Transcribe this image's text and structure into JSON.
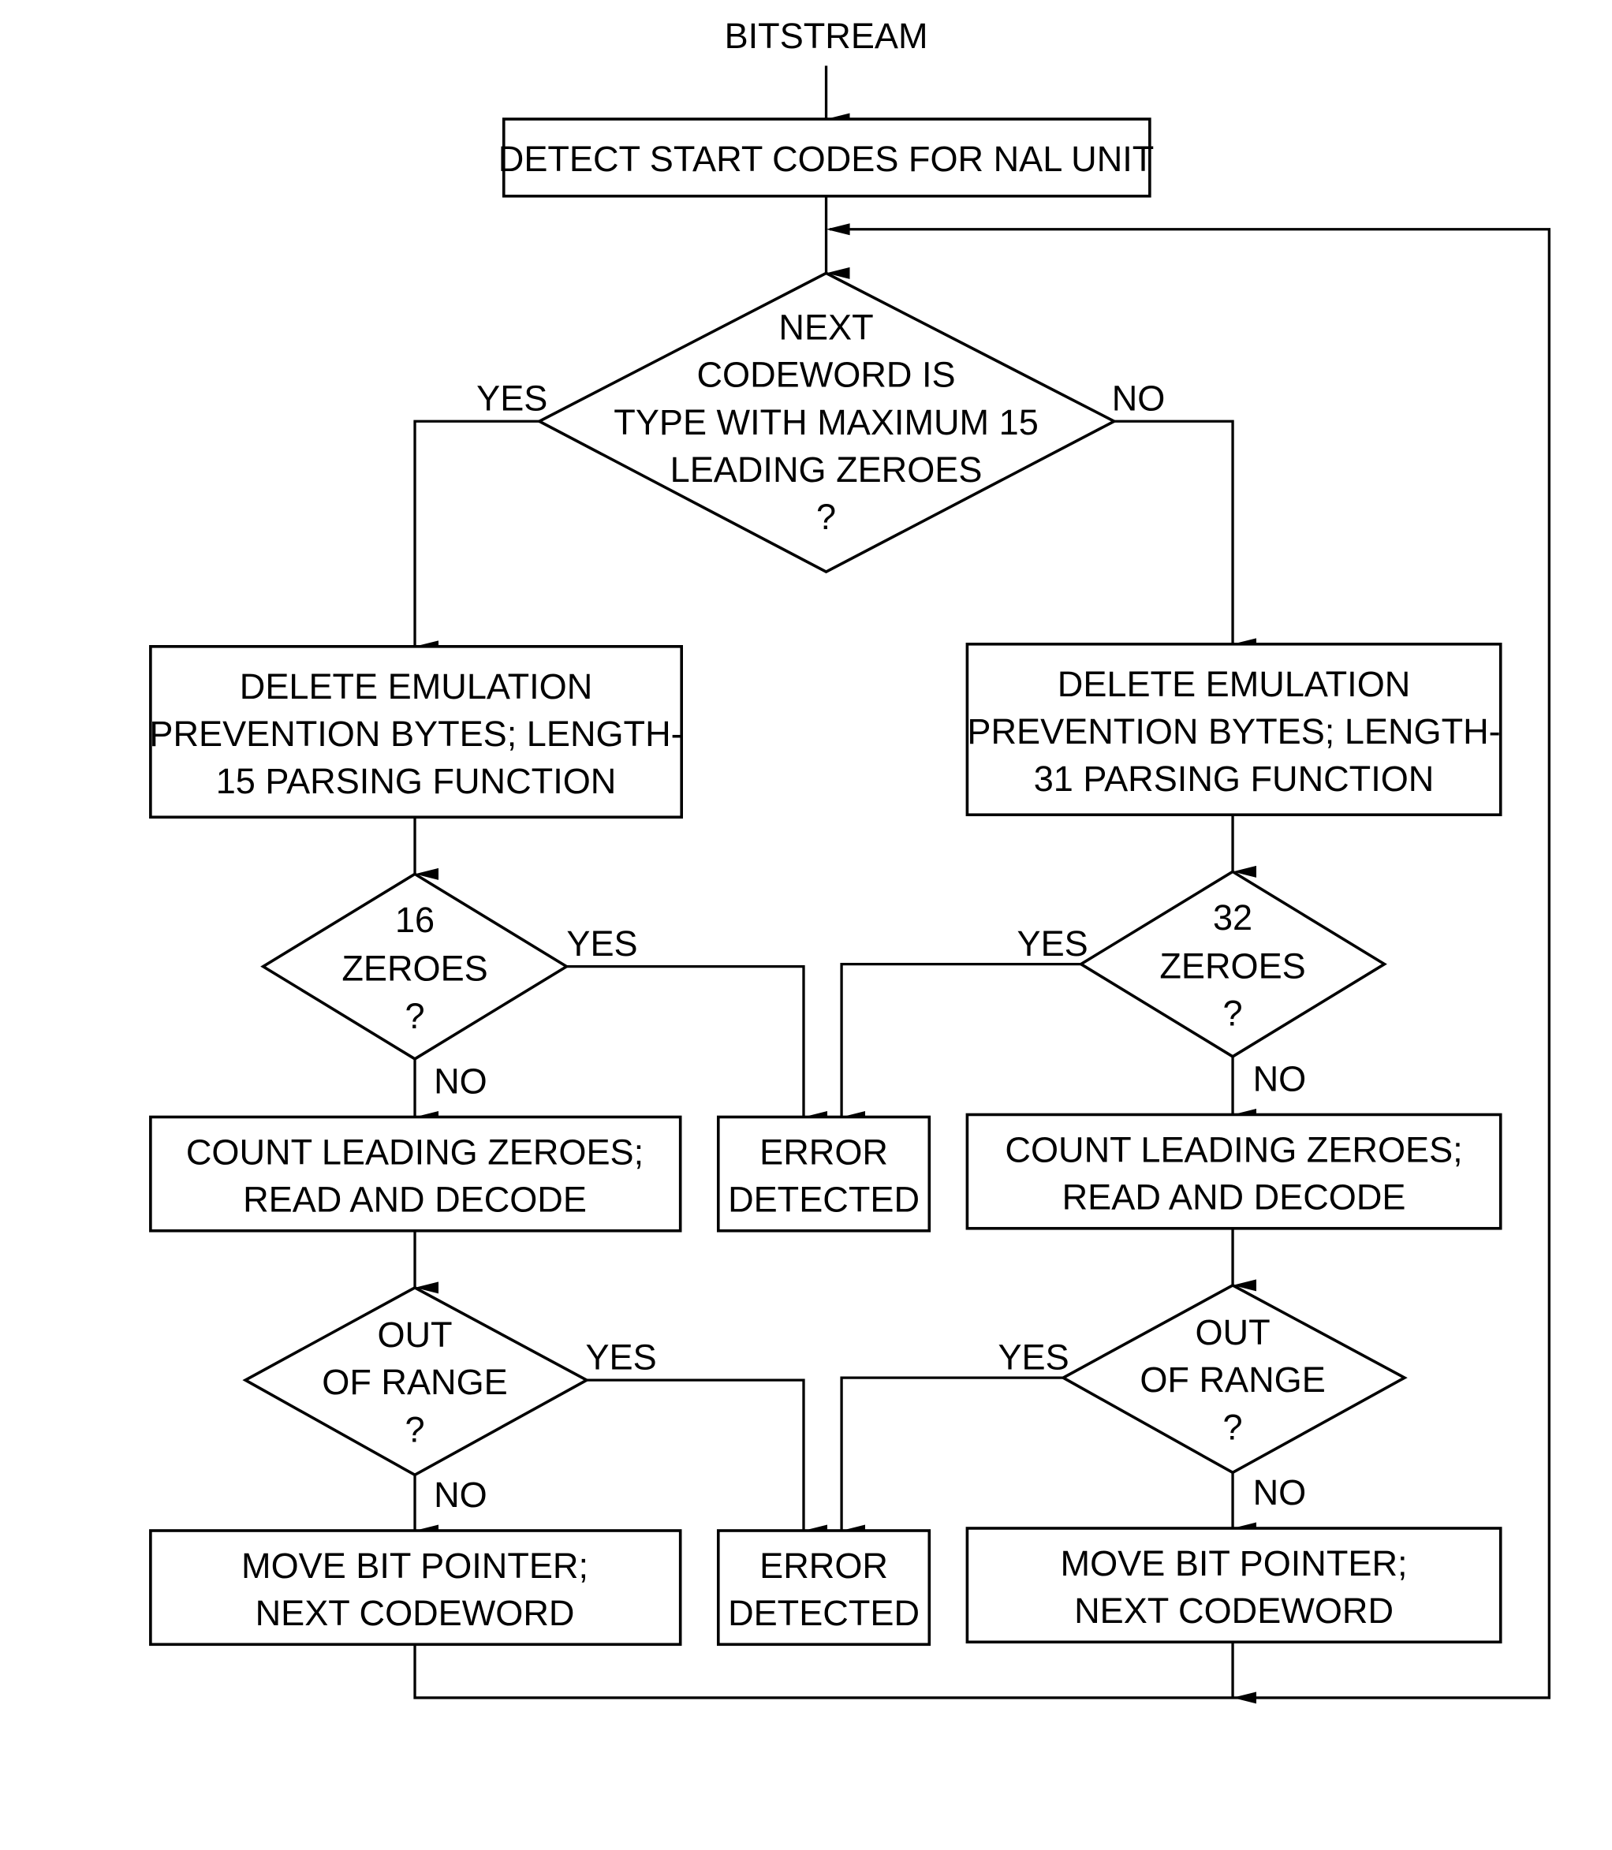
{
  "figure": {
    "type": "flowchart",
    "start_label": "BITSTREAM",
    "nodes": {
      "detect": {
        "kind": "process",
        "lines": [
          "DETECT START CODES FOR NAL UNIT"
        ]
      },
      "decision_main": {
        "kind": "decision",
        "lines": [
          "NEXT",
          "CODEWORD IS",
          "TYPE WITH MAXIMUM 15",
          "LEADING ZEROES",
          "?"
        ]
      },
      "delete15": {
        "kind": "process",
        "lines": [
          "DELETE EMULATION",
          "PREVENTION BYTES; LENGTH-",
          "15 PARSING FUNCTION"
        ]
      },
      "delete31": {
        "kind": "process",
        "lines": [
          "DELETE EMULATION",
          "PREVENTION BYTES; LENGTH-",
          "31 PARSING FUNCTION"
        ]
      },
      "zeroes16": {
        "kind": "decision",
        "lines": [
          "16",
          "ZEROES",
          "?"
        ]
      },
      "zeroes32": {
        "kind": "decision",
        "lines": [
          "32",
          "ZEROES",
          "?"
        ]
      },
      "count_left": {
        "kind": "process",
        "lines": [
          "COUNT LEADING ZEROES;",
          "READ AND DECODE"
        ]
      },
      "count_right": {
        "kind": "process",
        "lines": [
          "COUNT LEADING ZEROES;",
          "READ AND DECODE"
        ]
      },
      "error1": {
        "kind": "process",
        "lines": [
          "ERROR",
          "DETECTED"
        ]
      },
      "range_left": {
        "kind": "decision",
        "lines": [
          "OUT",
          "OF RANGE",
          "?"
        ]
      },
      "range_right": {
        "kind": "decision",
        "lines": [
          "OUT",
          "OF RANGE",
          "?"
        ]
      },
      "move_left": {
        "kind": "process",
        "lines": [
          "MOVE BIT POINTER;",
          "NEXT CODEWORD"
        ]
      },
      "move_right": {
        "kind": "process",
        "lines": [
          "MOVE BIT POINTER;",
          "NEXT CODEWORD"
        ]
      },
      "error2": {
        "kind": "process",
        "lines": [
          "ERROR",
          "DETECTED"
        ]
      }
    },
    "edge_labels": {
      "main_yes": "YES",
      "main_no": "NO",
      "z16_yes": "YES",
      "z16_no": "NO",
      "z32_yes": "YES",
      "z32_no": "NO",
      "rl_yes": "YES",
      "rl_no": "NO",
      "rr_yes": "YES",
      "rr_no": "NO"
    }
  }
}
